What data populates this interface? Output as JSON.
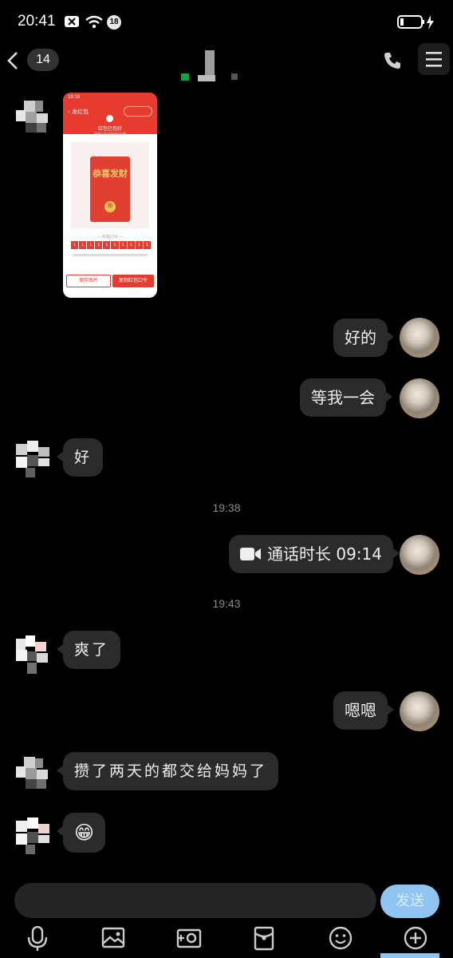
{
  "status": {
    "time": "20:41",
    "notification_count": "18"
  },
  "header": {
    "unread_count": "14"
  },
  "messages": {
    "m1_left_image": {
      "app_time": "19:18",
      "app_back_label": "发红包",
      "app_status": "红包已包好",
      "app_hint": "快把口令分享给好友吧",
      "envelope_text": "恭喜发财",
      "envelope_button": "開",
      "code_title": "— 红包口令 —",
      "code_chars": [
        "1",
        "1",
        "1",
        "1",
        "1",
        "1",
        "1",
        "1",
        "1",
        "1"
      ],
      "save_button": "保存图片",
      "copy_button": "复制红包口令"
    },
    "m2_right": "好的",
    "m3_right": "等我一会",
    "m4_left": "好",
    "ts1": "19:38",
    "m5_right_call": "通话时长 09:14",
    "ts2": "19:43",
    "m6_left": "爽了",
    "m7_right": "嗯嗯",
    "m8_left": "攒了两天的都交给妈妈了",
    "m9_left_emoji": "😁"
  },
  "input": {
    "send_label": "发送"
  },
  "toolbar": {
    "icons": [
      "mic-icon",
      "image-icon",
      "camera-icon",
      "red-packet-icon",
      "emoji-icon",
      "plus-icon"
    ]
  },
  "colors": {
    "background": "#000000",
    "bubble": "#2b2b2b",
    "send_button": "#8fc5f0",
    "red_packet": "#e63b2e"
  }
}
